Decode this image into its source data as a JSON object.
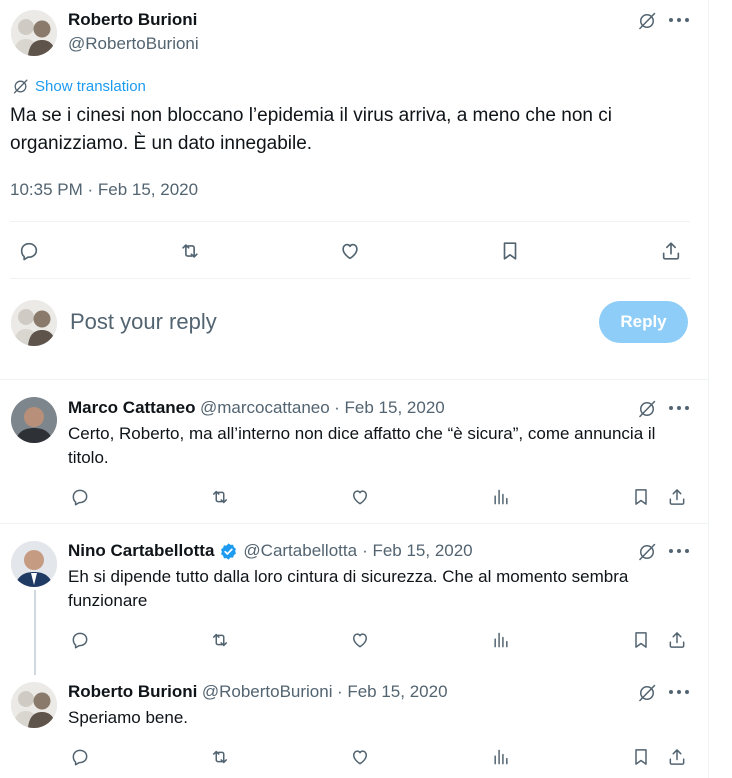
{
  "main_tweet": {
    "author_name": "Roberto Burioni",
    "author_handle": "@RobertoBurioni",
    "translate_label": "Show translation",
    "text": "Ma se i cinesi non bloccano l’epidemia il virus arriva, a meno che non ci organizziamo. È un dato innegabile.",
    "timestamp": "10:35 PM · Feb 15, 2020"
  },
  "composer": {
    "placeholder": "Post your reply",
    "reply_label": "Reply"
  },
  "replies": [
    {
      "name": "Marco Cattaneo",
      "handle": "@marcocattaneo",
      "date": "· Feb 15, 2020",
      "text": "Certo, Roberto, ma all’interno non dice affatto che “è sicura”, come annuncia il titolo.",
      "verified": false
    },
    {
      "name": "Nino Cartabellotta",
      "handle": "@Cartabellotta",
      "date": "· Feb 15, 2020",
      "text": "Eh si dipende tutto dalla loro cintura di sicurezza. Che al momento sembra funzionare",
      "verified": true
    },
    {
      "name": "Roberto Burioni",
      "handle": "@RobertoBurioni",
      "date": "· Feb 15, 2020",
      "text": "Speriamo bene.",
      "verified": false
    }
  ],
  "icons": {
    "reply": "reply-icon",
    "repost": "repost-icon",
    "like": "like-icon",
    "views": "views-icon",
    "bookmark": "bookmark-icon",
    "share": "share-icon",
    "grok": "grok-icon",
    "more": "more-icon",
    "verified": "verified-badge-icon"
  },
  "colors": {
    "text": "#0f1419",
    "muted": "#536471",
    "link": "#1d9bf0",
    "reply_button": "#8ecdf8",
    "divider": "#eff3f4"
  }
}
